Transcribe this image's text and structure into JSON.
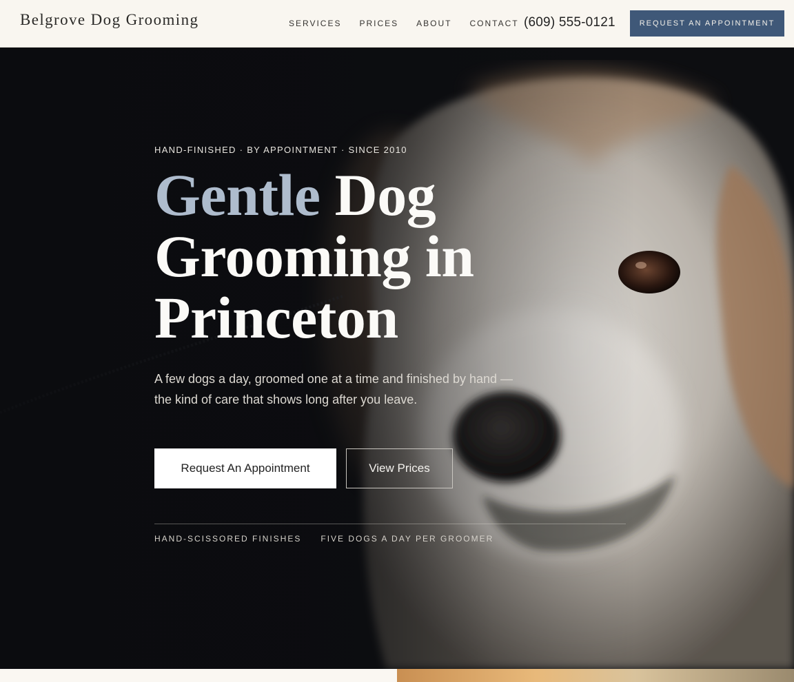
{
  "header": {
    "logo": "Belgrove Dog Grooming",
    "nav": [
      {
        "label": "SERVICES"
      },
      {
        "label": "PRICES"
      },
      {
        "label": "ABOUT"
      },
      {
        "label": "CONTACT"
      }
    ],
    "phone": "(609) 555-0121",
    "cta_label": "REQUEST AN APPOINTMENT"
  },
  "hero": {
    "eyebrow": "HAND-FINISHED · BY APPOINTMENT · SINCE 2010",
    "headline_accent": "Gentle",
    "headline_rest": "Dog Grooming in Princeton",
    "subhead": "A few dogs a day, groomed one at a time and finished by hand — the kind of care that shows long after you leave.",
    "primary_button": "Request An Appointment",
    "secondary_button": "View Prices",
    "features": [
      {
        "label": "HAND-SCISSORED FINISHES"
      },
      {
        "label": "FIVE DOGS A DAY PER GROOMER"
      }
    ]
  },
  "colors": {
    "accent_navy": "#3f5878",
    "headline_accent": "#aebccd",
    "header_bg": "#f9f6f0",
    "hero_bg": "#0d0e11"
  }
}
